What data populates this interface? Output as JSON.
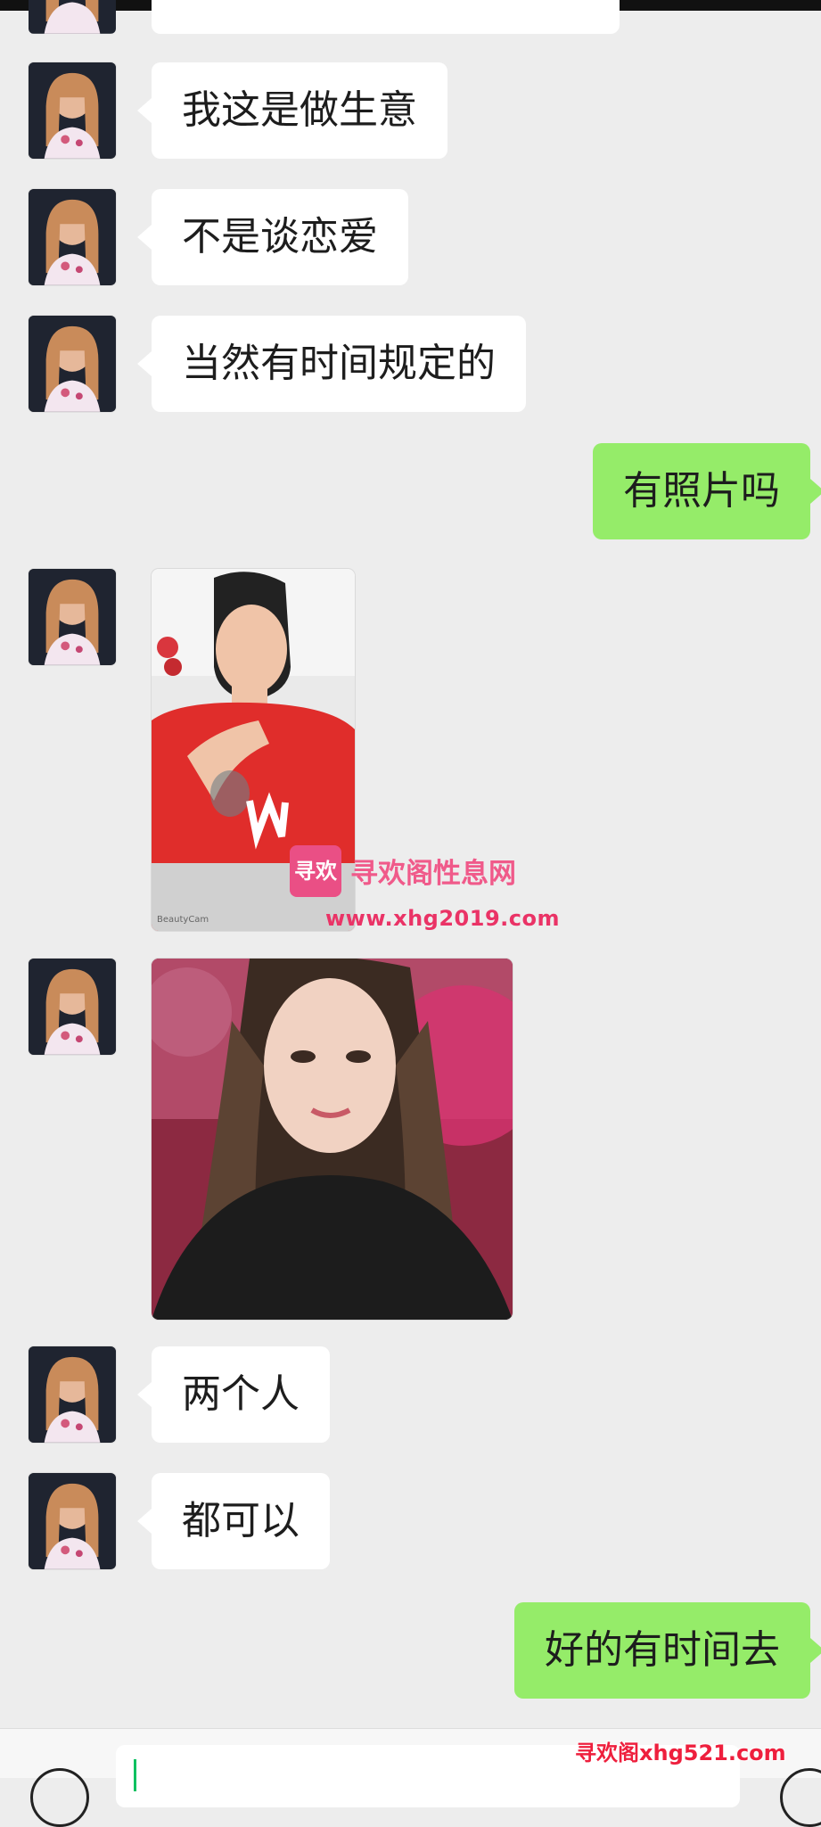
{
  "messages": [
    {
      "side": "incoming",
      "type": "text",
      "text": "我这是做生意"
    },
    {
      "side": "incoming",
      "type": "text",
      "text": "不是谈恋爱"
    },
    {
      "side": "incoming",
      "type": "text",
      "text": "当然有时间规定的"
    },
    {
      "side": "outgoing",
      "type": "text",
      "text": "有照片吗"
    },
    {
      "side": "incoming",
      "type": "image",
      "description": "woman in red shirt selfie"
    },
    {
      "side": "incoming",
      "type": "image",
      "description": "woman portrait in black jacket"
    },
    {
      "side": "incoming",
      "type": "text",
      "text": "两个人"
    },
    {
      "side": "incoming",
      "type": "text",
      "text": "都可以"
    },
    {
      "side": "outgoing",
      "type": "text",
      "text": "好的有时间去"
    }
  ],
  "watermark": {
    "logo": "寻欢",
    "title": "寻欢阁性息网",
    "url": "www.xhg2019.com"
  },
  "footer": {
    "site_mark": "寻欢阁xhg521.com"
  },
  "colors": {
    "background": "#ededed",
    "incoming_bubble": "#ffffff",
    "outgoing_bubble": "#95ec69",
    "text": "#1d1d1d",
    "watermark_pink": "#f05a8a",
    "site_mark_red": "#ee1f3d"
  },
  "icons": {
    "voice": "voice-icon",
    "more": "plus-icon"
  }
}
